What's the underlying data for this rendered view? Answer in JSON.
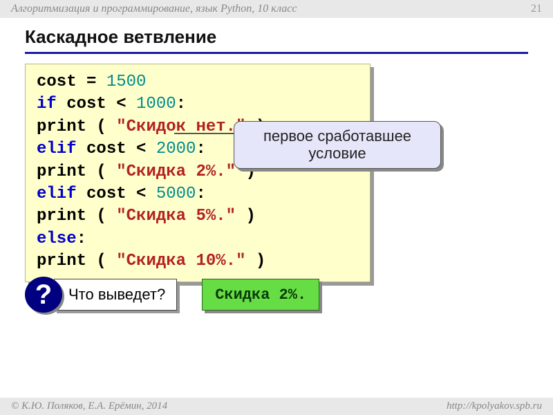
{
  "header": {
    "course": "Алгоритмизация и программирование, язык Python, 10 класс",
    "page_number": "21"
  },
  "title": "Каскадное ветвление",
  "code": {
    "l1_a": "cost = ",
    "l1_num": "1500",
    "l2_kw": "if",
    "l2_a": " cost < ",
    "l2_num": "1000",
    "l2_colon": ":",
    "l3_ind": "   ",
    "l3_fn": "print",
    "l3_a": " ( ",
    "l3_str": "\"Скидок нет.\"",
    "l3_b": " )",
    "l4_kw": "elif",
    "l4_a": " cost < ",
    "l4_num": "2000",
    "l4_colon": ":",
    "l5_ind": "   ",
    "l5_fn": "print",
    "l5_a": " ( ",
    "l5_str": "\"Скидка 2%.\"",
    "l5_b": " )",
    "l6_kw": "elif",
    "l6_a": " cost < ",
    "l6_num": "5000",
    "l6_colon": ":",
    "l7_ind": "   ",
    "l7_fn": "print",
    "l7_a": " ( ",
    "l7_str": "\"Скидка 5%.\"",
    "l7_b": " )",
    "l8_kw": "else",
    "l8_colon": ":",
    "l9_ind": "   ",
    "l9_fn": "print",
    "l9_a": " ( ",
    "l9_str": "\"Скидка 10%.\"",
    "l9_b": " )"
  },
  "callout": {
    "line1": "первое сработавшее",
    "line2": "условие"
  },
  "question": {
    "badge": "?",
    "text": "Что выведет?"
  },
  "answer": "Скидка 2%.",
  "footer": {
    "authors": "© К.Ю. Поляков, Е.А. Ерёмин, 2014",
    "url": "http://kpolyakov.spb.ru"
  }
}
